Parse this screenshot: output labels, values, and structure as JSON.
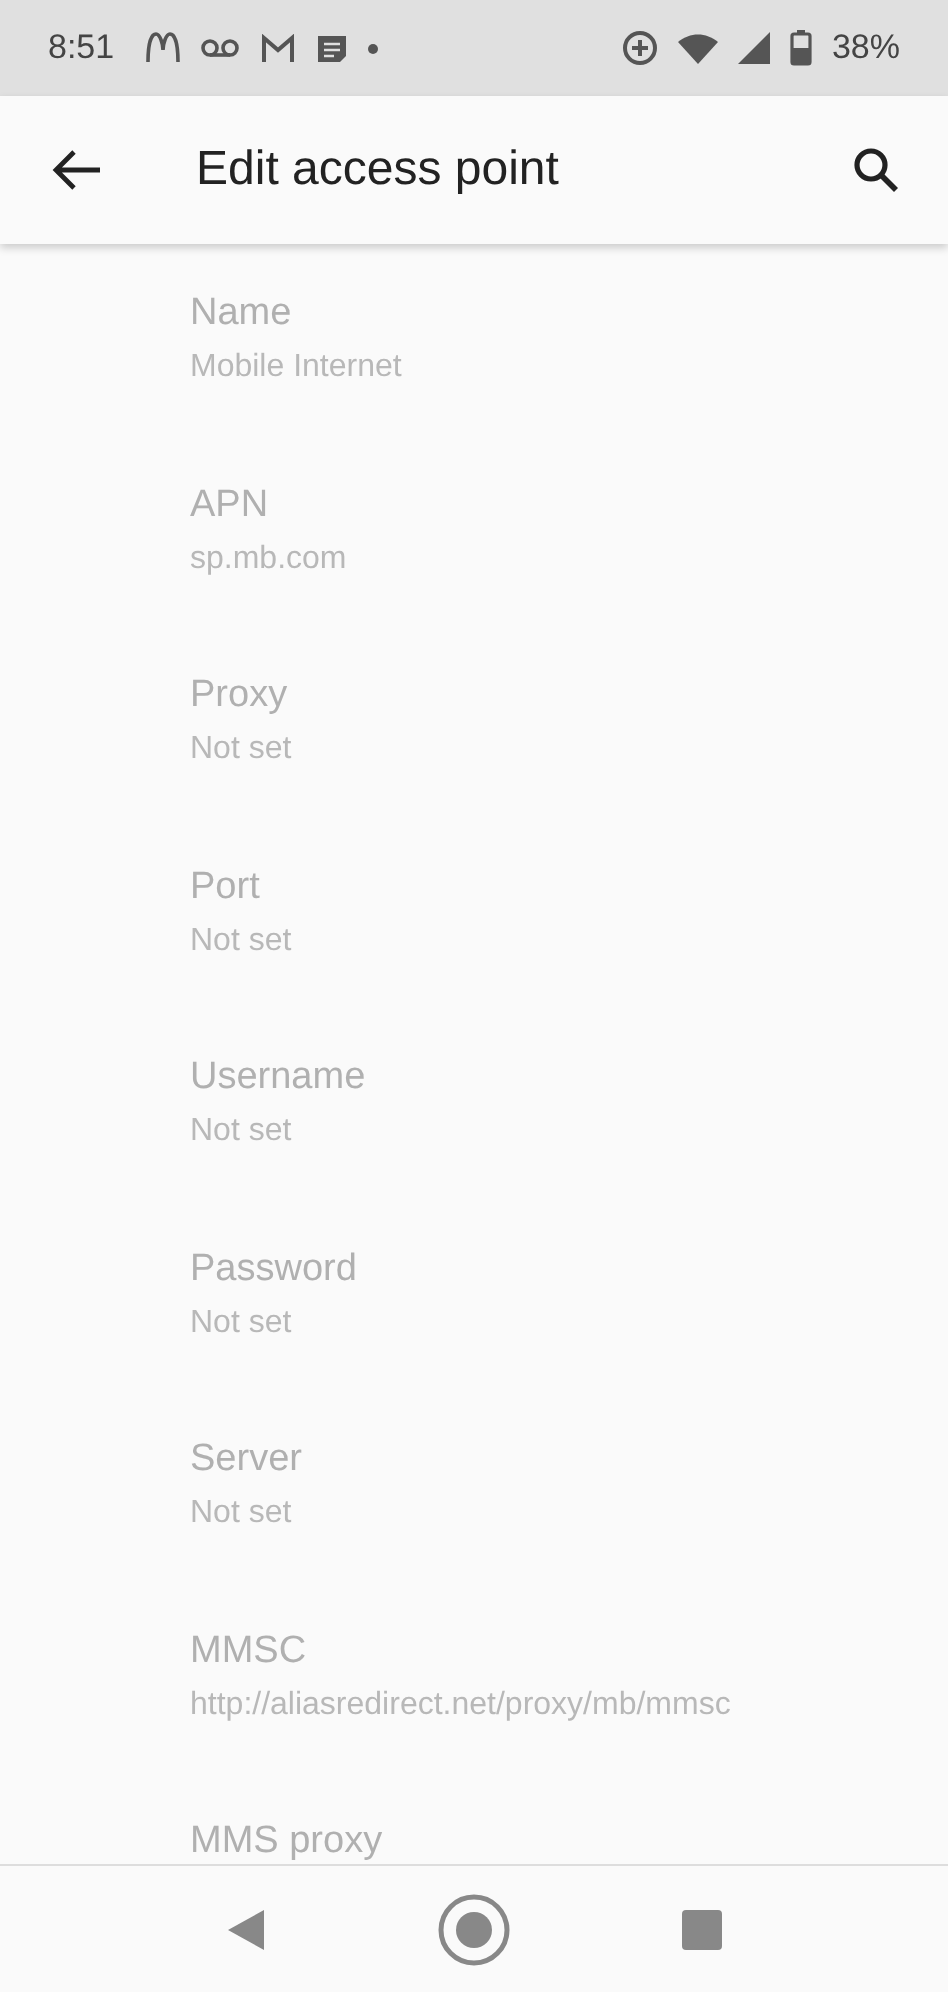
{
  "status_bar": {
    "time": "8:51",
    "battery": "38%"
  },
  "toolbar": {
    "title": "Edit access point"
  },
  "settings": [
    {
      "label": "Name",
      "value": "Mobile Internet",
      "disabled": true
    },
    {
      "label": "APN",
      "value": "sp.mb.com",
      "disabled": true
    },
    {
      "label": "Proxy",
      "value": "Not set",
      "disabled": true
    },
    {
      "label": "Port",
      "value": "Not set",
      "disabled": true
    },
    {
      "label": "Username",
      "value": "Not set",
      "disabled": true
    },
    {
      "label": "Password",
      "value": "Not set",
      "disabled": true
    },
    {
      "label": "Server",
      "value": "Not set",
      "disabled": true
    },
    {
      "label": "MMSC",
      "value": "http://aliasredirect.net/proxy/mb/mmsc",
      "disabled": true
    },
    {
      "label": "MMS proxy",
      "disabled": true
    }
  ]
}
